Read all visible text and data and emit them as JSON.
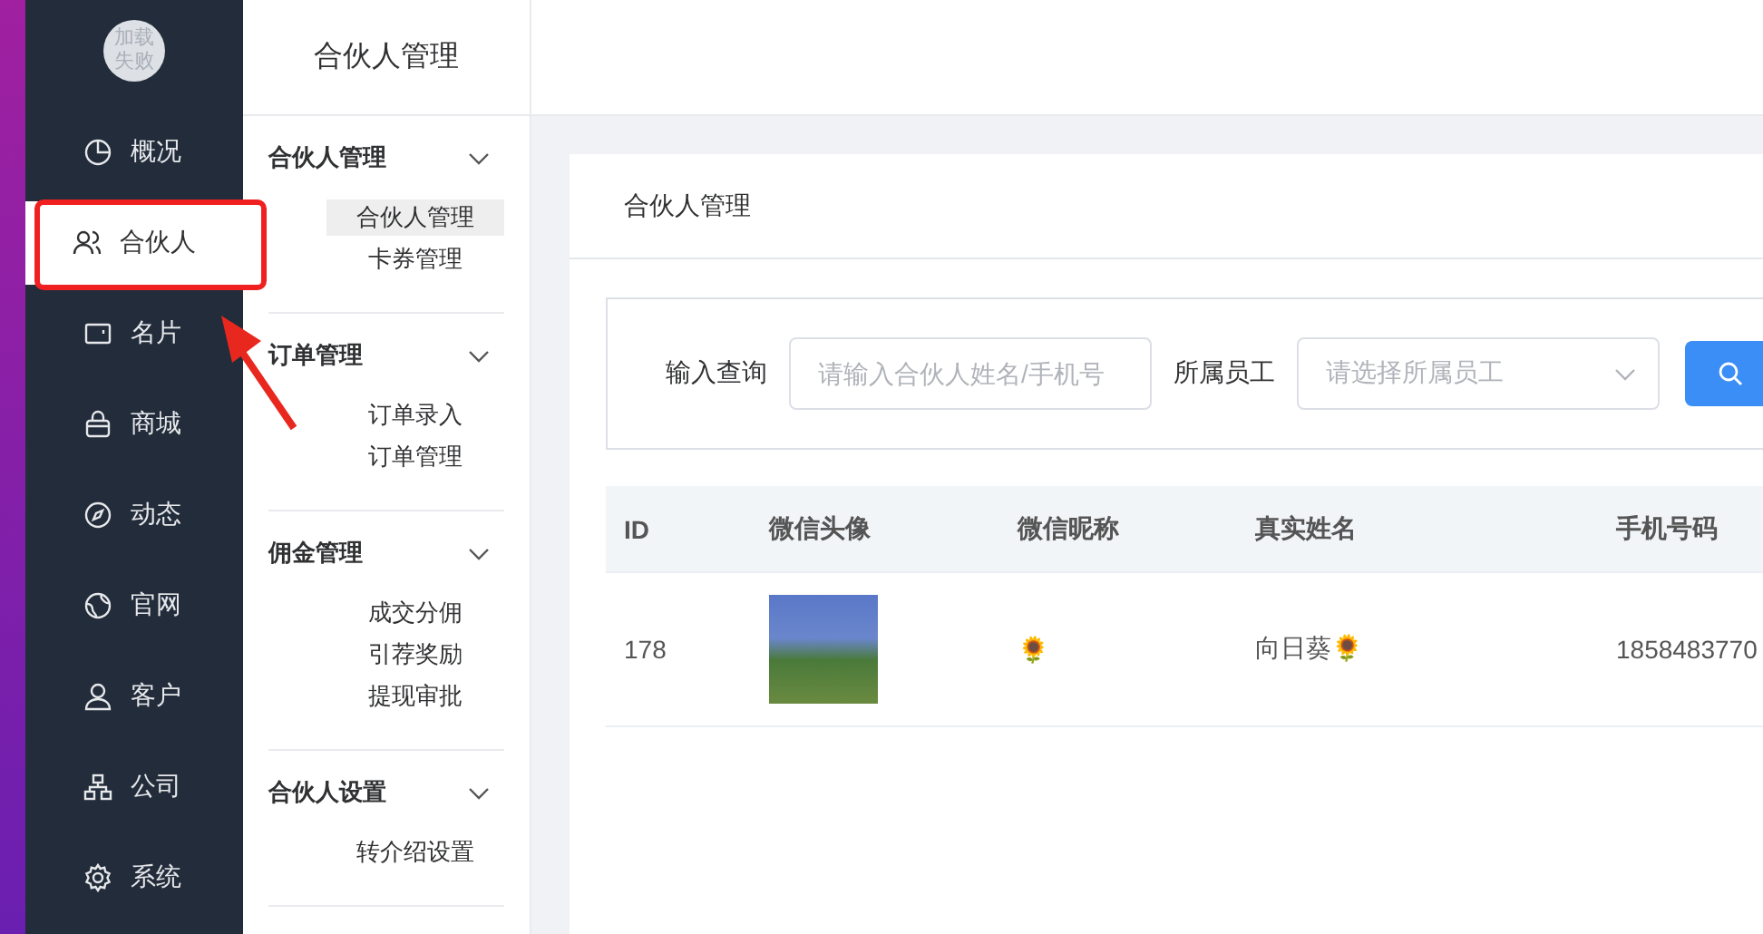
{
  "sidebar": {
    "avatar_text": "加载失败",
    "items": [
      {
        "label": "概况",
        "selected": false
      },
      {
        "label": "合伙人",
        "selected": true
      },
      {
        "label": "名片",
        "selected": false
      },
      {
        "label": "商城",
        "selected": false
      },
      {
        "label": "动态",
        "selected": false
      },
      {
        "label": "官网",
        "selected": false
      },
      {
        "label": "客户",
        "selected": false
      },
      {
        "label": "公司",
        "selected": false
      },
      {
        "label": "系统",
        "selected": false
      }
    ]
  },
  "submenu": {
    "title": "合伙人管理",
    "groups": [
      {
        "title": "合伙人管理",
        "items": [
          {
            "label": "合伙人管理",
            "selected": true
          },
          {
            "label": "卡券管理",
            "selected": false
          }
        ]
      },
      {
        "title": "订单管理",
        "items": [
          {
            "label": "订单录入",
            "selected": false
          },
          {
            "label": "订单管理",
            "selected": false
          }
        ]
      },
      {
        "title": "佣金管理",
        "items": [
          {
            "label": "成交分佣",
            "selected": false
          },
          {
            "label": "引荐奖励",
            "selected": false
          },
          {
            "label": "提现审批",
            "selected": false
          }
        ]
      },
      {
        "title": "合伙人设置",
        "items": [
          {
            "label": "转介绍设置",
            "selected": false
          }
        ]
      }
    ]
  },
  "card_title": "合伙人管理",
  "search": {
    "query_label": "输入查询",
    "query_placeholder": "请输入合伙人姓名/手机号",
    "staff_label": "所属员工",
    "staff_placeholder": "请选择所属员工"
  },
  "table": {
    "columns": [
      "ID",
      "微信头像",
      "微信昵称",
      "真实姓名",
      "手机号码"
    ],
    "rows": [
      {
        "id": "178",
        "nickname": "🌻",
        "real_name": "向日葵🌻",
        "phone": "1858483770"
      }
    ]
  }
}
